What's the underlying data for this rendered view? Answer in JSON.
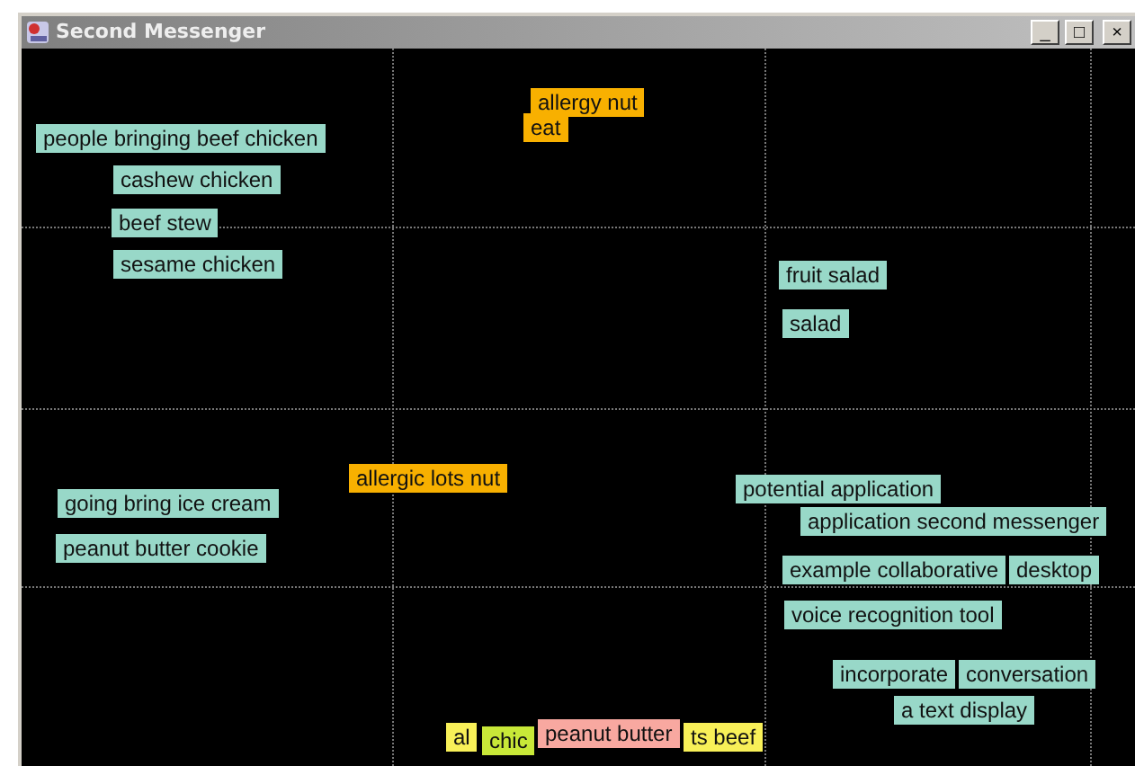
{
  "window": {
    "title": "Second Messenger",
    "controls": [
      "_",
      "□",
      "×"
    ]
  },
  "tags": [
    {
      "text": "allergy nut",
      "color": "#f8b000"
    },
    {
      "text": "eat",
      "color": "#f8b000"
    },
    {
      "text": "people bringing beef chicken",
      "color": "#98d8c8"
    },
    {
      "text": "cashew chicken",
      "color": "#98d8c8"
    },
    {
      "text": "beef stew",
      "color": "#98d8c8"
    },
    {
      "text": "sesame chicken",
      "color": "#98d8c8"
    },
    {
      "text": "fruit salad",
      "color": "#98d8c8"
    },
    {
      "text": "salad",
      "color": "#98d8c8"
    },
    {
      "text": "allergic lots nut",
      "color": "#f8b000"
    },
    {
      "text": "going bring ice cream",
      "color": "#98d8c8"
    },
    {
      "text": "peanut butter cookie",
      "color": "#98d8c8"
    },
    {
      "text": "potential application",
      "color": "#98d8c8"
    },
    {
      "text": "application second messenger",
      "color": "#98d8c8"
    },
    {
      "text": "example collaborative",
      "color": "#98d8c8"
    },
    {
      "text": "desktop",
      "color": "#98d8c8"
    },
    {
      "text": "voice recognition tool",
      "color": "#98d8c8"
    },
    {
      "text": "incorporate",
      "color": "#98d8c8"
    },
    {
      "text": "conversation",
      "color": "#98d8c8"
    },
    {
      "text": "a text display",
      "color": "#98d8c8"
    },
    {
      "text": "al",
      "color": "#f8f058"
    },
    {
      "text": "chic",
      "color": "#c8e838"
    },
    {
      "text": "peanut butter",
      "color": "#f8a8a0"
    },
    {
      "text": "ts beef",
      "color": "#f8f058"
    }
  ]
}
